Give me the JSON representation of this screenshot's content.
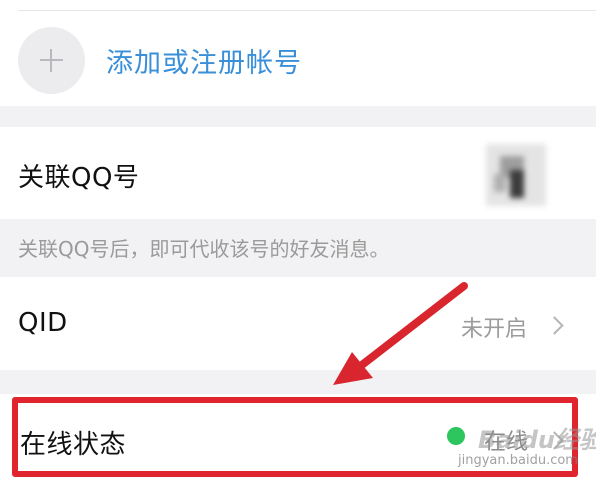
{
  "add_account": {
    "label": "添加或注册帐号",
    "icon": "plus-icon"
  },
  "link_qq": {
    "label": "关联QQ号",
    "avatar": "blurred-avatar"
  },
  "link_qq_hint": "关联QQ号后，即可代收该号的好友消息。",
  "qid": {
    "label": "QID",
    "value": "未开启"
  },
  "online_status": {
    "label": "在线状态",
    "value": "在线",
    "status_color": "#2dc55e"
  },
  "watermark": {
    "brand": "Baidu经验",
    "url": "jingyan.baidu.com"
  },
  "colors": {
    "link": "#3a8fd9",
    "highlight_border": "#e1252e",
    "arrow": "#d9262e"
  }
}
